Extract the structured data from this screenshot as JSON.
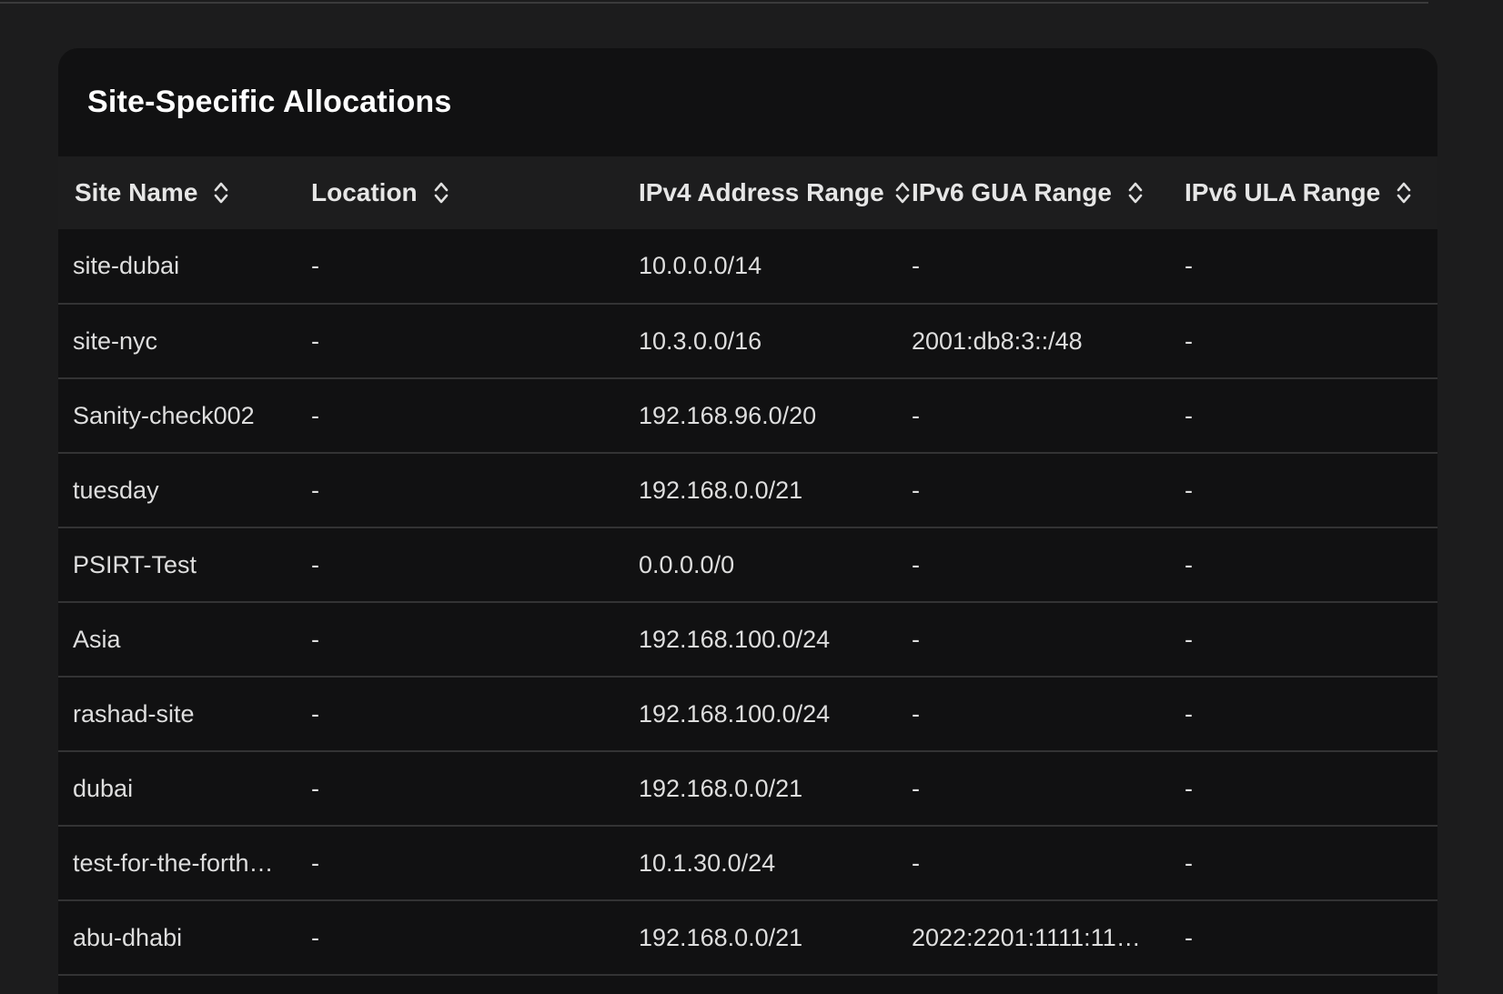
{
  "section": {
    "title": "Site-Specific Allocations"
  },
  "table": {
    "columns": [
      {
        "label": "Site Name",
        "icon": "sort-icon"
      },
      {
        "label": "Location",
        "icon": "sort-icon"
      },
      {
        "label": "IPv4 Address Range",
        "icon": "sort-icon"
      },
      {
        "label": "IPv6 GUA Range",
        "icon": "sort-icon"
      },
      {
        "label": "IPv6 ULA Range",
        "icon": "sort-icon"
      }
    ],
    "rows": [
      {
        "site": "site-dubai",
        "location": "-",
        "ipv4": "10.0.0.0/14",
        "gua": "-",
        "ula": "-"
      },
      {
        "site": "site-nyc",
        "location": "-",
        "ipv4": "10.3.0.0/16",
        "gua": "2001:db8:3::/48",
        "ula": "-"
      },
      {
        "site": "Sanity-check002",
        "location": "-",
        "ipv4": "192.168.96.0/20",
        "gua": "-",
        "ula": "-"
      },
      {
        "site": "tuesday",
        "location": "-",
        "ipv4": "192.168.0.0/21",
        "gua": "-",
        "ula": "-"
      },
      {
        "site": "PSIRT-Test",
        "location": "-",
        "ipv4": "0.0.0.0/0",
        "gua": "-",
        "ula": "-"
      },
      {
        "site": "Asia",
        "location": "-",
        "ipv4": "192.168.100.0/24",
        "gua": "-",
        "ula": "-"
      },
      {
        "site": "rashad-site",
        "location": "-",
        "ipv4": "192.168.100.0/24",
        "gua": "-",
        "ula": "-"
      },
      {
        "site": "dubai",
        "location": "-",
        "ipv4": "192.168.0.0/21",
        "gua": "-",
        "ula": "-"
      },
      {
        "site": "test-for-the-forth…",
        "location": "-",
        "ipv4": "10.1.30.0/24",
        "gua": "-",
        "ula": "-"
      },
      {
        "site": "abu-dhabi",
        "location": "-",
        "ipv4": "192.168.0.0/21",
        "gua": "2022:2201:1111:11…",
        "ula": "-"
      }
    ]
  },
  "colors": {
    "page_bg": "#1c1c1d",
    "card_bg": "#111112",
    "header_bg": "#1d1d1e",
    "divider": "#333334",
    "text": "#dedede"
  }
}
